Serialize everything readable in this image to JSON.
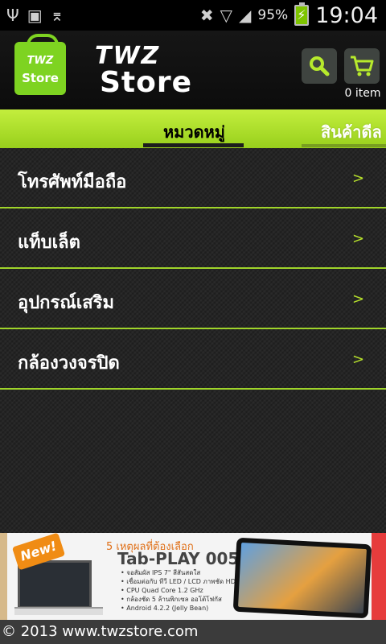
{
  "status_bar": {
    "signal_percent": "95%",
    "time": "19:04",
    "icons": [
      "usb-icon",
      "sd-card-icon",
      "wifi-off-icon",
      "mute-icon",
      "wifi-icon",
      "signal-icon",
      "battery-charging-icon"
    ]
  },
  "header": {
    "logo_brand": "TWZ",
    "logo_word": "Store",
    "bag_brand": "TWZ",
    "bag_word": "Store",
    "cart_count": "0 item"
  },
  "tabs": [
    {
      "label": "หมวดหมู่",
      "active": true
    },
    {
      "label": "สินค้าดีล",
      "active": false
    }
  ],
  "categories": [
    {
      "label": "โทรศัพท์มือถือ",
      "arrow": ">"
    },
    {
      "label": "แท็บเล็ต",
      "arrow": ">"
    },
    {
      "label": "อุปกรณ์เสริม",
      "arrow": ">"
    },
    {
      "label": "กล้องวงจรปิด",
      "arrow": ">"
    }
  ],
  "banner": {
    "badge": "New!",
    "headline": "5 เหตุผลที่ต้องเลือก",
    "product": "Tab-PLAY 005",
    "specs": [
      "• จอสัมผัส IPS 7\" สีสันสดใส",
      "• เชื่อมต่อกับ ทีวี LED / LCD ภาพชัด HD",
      "• CPU Quad Core 1.2 GHz",
      "• กล้องชัด 5 ล้านพิกเซล ออโต้โฟกัส",
      "• Android 4.2.2 (Jelly Bean)"
    ]
  },
  "footer": {
    "text": "© 2013 www.twzstore.com"
  },
  "colors": {
    "accent_green": "#9fd42a",
    "tab_bar": "#b7e535",
    "list_bg": "#252525"
  }
}
